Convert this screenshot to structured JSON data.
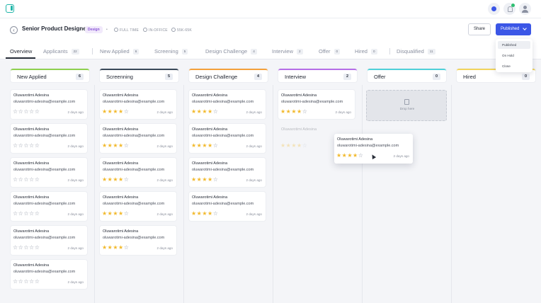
{
  "header": {
    "job_title": "Senior Product Designer",
    "badge": "Design",
    "meta": [
      "FULL TIME",
      "IN-OFFICE",
      "55K-65K"
    ],
    "share_label": "Share",
    "publish_label": "Published",
    "status_options": [
      "Published",
      "On Hold",
      "Close"
    ],
    "selected_status": "Published"
  },
  "tabs": [
    {
      "label": "Overview",
      "count": ""
    },
    {
      "label": "Applicants",
      "count": "22"
    },
    {
      "label": "New Applied",
      "count": "6"
    },
    {
      "label": "Screening",
      "count": "5"
    },
    {
      "label": "Design Challenge",
      "count": "4"
    },
    {
      "label": "Interview",
      "count": "2"
    },
    {
      "label": "Offer",
      "count": "0"
    },
    {
      "label": "Hired",
      "count": "0"
    },
    {
      "label": "Disqualified",
      "count": "11"
    }
  ],
  "columns": [
    {
      "title": "New Applied",
      "count": "6",
      "color": "#8fd14f"
    },
    {
      "title": "Screenning",
      "count": "5",
      "color": "#3b4a5a"
    },
    {
      "title": "Design Challenge",
      "count": "4",
      "color": "#f5a13b"
    },
    {
      "title": "Interview",
      "count": "2",
      "color": "#b66ee8"
    },
    {
      "title": "Offer",
      "count": "0",
      "color": "#4fd1d9"
    },
    {
      "title": "Hired",
      "count": "0",
      "color": "#f2d45c"
    }
  ],
  "card": {
    "name": "Oluwarotimi Adesina",
    "email": "oluwarotimi-adesina@example.com",
    "time": "2 days ago"
  },
  "ratings": {
    "new_applied": 0,
    "screening": 4,
    "design_challenge": 4,
    "interview": 4,
    "dragged": 4
  },
  "dropzone_label": "Drop here",
  "colors": {
    "accent": "#3b56e6",
    "star": "#f2b92c"
  }
}
